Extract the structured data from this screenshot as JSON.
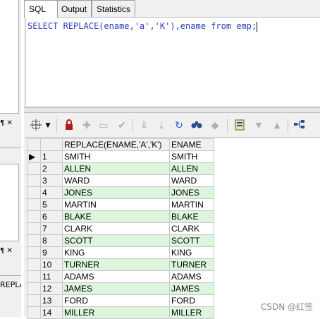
{
  "left_panel": {
    "pin_close_1": "¶ ✕",
    "pin_close_2": "¶ ✕",
    "truncated_text": "REPLA"
  },
  "tabs": [
    {
      "label": "SQL",
      "active": true
    },
    {
      "label": "Output",
      "active": false
    },
    {
      "label": "Statistics",
      "active": false
    }
  ],
  "editor": {
    "kw_select": "SELECT",
    "fn_replace": "REPLACE(ename,",
    "arg_a": "'a'",
    "comma": ",",
    "arg_k": "'K'",
    "rest": "),ename",
    "kw_from": "from",
    "table": "emp;"
  },
  "toolbar": {
    "icons": [
      "grid-select-icon",
      "dropdown-arrow-icon",
      "lock-icon",
      "new-record-icon",
      "delete-record-icon",
      "post-edit-icon",
      "fetch-next-icon",
      "fetch-last-icon",
      "refresh-icon",
      "find-icon",
      "clear-icon",
      "export-icon",
      "sort-down-icon",
      "sort-up-icon",
      "tree-icon"
    ]
  },
  "grid": {
    "columns": [
      "REPLACE(ENAME,'A','K')",
      "ENAME"
    ],
    "rows": [
      {
        "n": "1",
        "replaced": "SMITH",
        "ename": "SMITH"
      },
      {
        "n": "2",
        "replaced": "ALLEN",
        "ename": "ALLEN"
      },
      {
        "n": "3",
        "replaced": "WARD",
        "ename": "WARD"
      },
      {
        "n": "4",
        "replaced": "JONES",
        "ename": "JONES"
      },
      {
        "n": "5",
        "replaced": "MARTIN",
        "ename": "MARTIN"
      },
      {
        "n": "6",
        "replaced": "BLAKE",
        "ename": "BLAKE"
      },
      {
        "n": "7",
        "replaced": "CLARK",
        "ename": "CLARK"
      },
      {
        "n": "8",
        "replaced": "SCOTT",
        "ename": "SCOTT"
      },
      {
        "n": "9",
        "replaced": "KING",
        "ename": "KING"
      },
      {
        "n": "10",
        "replaced": "TURNER",
        "ename": "TURNER"
      },
      {
        "n": "11",
        "replaced": "ADAMS",
        "ename": "ADAMS"
      },
      {
        "n": "12",
        "replaced": "JAMES",
        "ename": "JAMES"
      },
      {
        "n": "13",
        "replaced": "FORD",
        "ename": "FORD"
      },
      {
        "n": "14",
        "replaced": "MILLER",
        "ename": "MILLER"
      }
    ],
    "current_row_marker": "▶"
  },
  "watermark": "CSDN @红签",
  "colors": {
    "keyword": "#2a3cbf",
    "alt_row": "#dcf5dc",
    "panel_bg": "#f0f0f0"
  }
}
